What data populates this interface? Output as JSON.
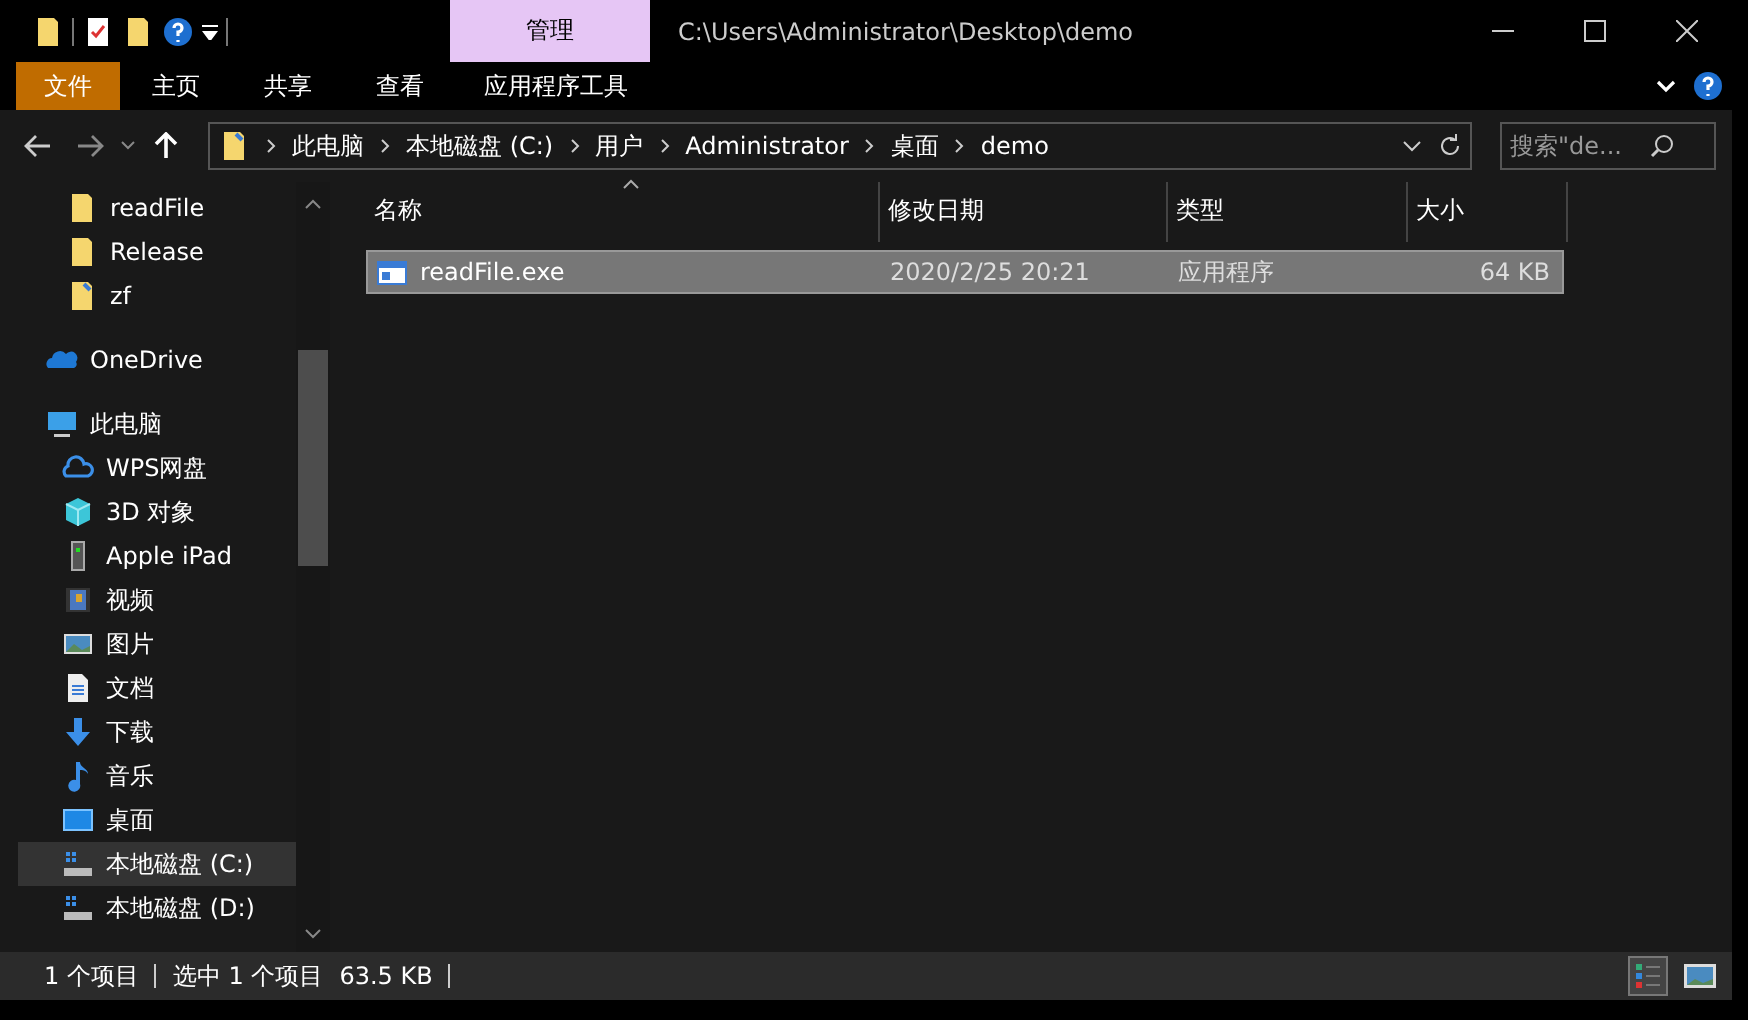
{
  "window": {
    "title": "C:\\Users\\Administrator\\Desktop\\demo",
    "context_tab": "管理"
  },
  "ribbon_tabs": [
    {
      "label": "文件",
      "kind": "file"
    },
    {
      "label": "主页",
      "kind": "tab"
    },
    {
      "label": "共享",
      "kind": "tab"
    },
    {
      "label": "查看",
      "kind": "tab"
    },
    {
      "label": "应用程序工具",
      "kind": "context"
    }
  ],
  "address_bar": {
    "segments": [
      "此电脑",
      "本地磁盘 (C:)",
      "用户",
      "Administrator",
      "桌面",
      "demo"
    ]
  },
  "search": {
    "placeholder": "搜索\"de..."
  },
  "sidebar": {
    "pinned": [
      {
        "label": "readFile",
        "kind": "folder",
        "selected": false
      },
      {
        "label": "Release",
        "kind": "folder",
        "selected": false
      },
      {
        "label": "zf",
        "kind": "folder-pin",
        "selected": false
      }
    ],
    "items": [
      {
        "label": "OneDrive",
        "kind": "cloud",
        "selected": false
      },
      {
        "label": "此电脑",
        "kind": "pc",
        "selected": false,
        "children": [
          {
            "label": "WPS网盘",
            "kind": "cloud-outline",
            "selected": false
          },
          {
            "label": "3D 对象",
            "kind": "cube",
            "selected": false
          },
          {
            "label": "Apple iPad",
            "kind": "device",
            "selected": false
          },
          {
            "label": "视频",
            "kind": "video",
            "selected": false
          },
          {
            "label": "图片",
            "kind": "picture",
            "selected": false
          },
          {
            "label": "文档",
            "kind": "document",
            "selected": false
          },
          {
            "label": "下载",
            "kind": "download",
            "selected": false
          },
          {
            "label": "音乐",
            "kind": "music",
            "selected": false
          },
          {
            "label": "桌面",
            "kind": "desktop",
            "selected": false
          },
          {
            "label": "本地磁盘 (C:)",
            "kind": "drive",
            "selected": true
          },
          {
            "label": "本地磁盘 (D:)",
            "kind": "drive",
            "selected": false
          }
        ]
      }
    ]
  },
  "table": {
    "columns": [
      {
        "label": "名称",
        "sorted": true
      },
      {
        "label": "修改日期",
        "sorted": false
      },
      {
        "label": "类型",
        "sorted": false
      },
      {
        "label": "大小",
        "sorted": false
      }
    ],
    "rows": [
      {
        "name": "readFile.exe",
        "date": "2020/2/25 20:21",
        "type": "应用程序",
        "size": "64 KB",
        "selected": true
      }
    ]
  },
  "status_bar": {
    "items": [
      "1 个项目",
      "选中 1 个项目",
      "63.5 KB"
    ],
    "views": [
      {
        "kind": "details",
        "selected": true
      },
      {
        "kind": "thumbnails",
        "selected": false
      }
    ]
  }
}
